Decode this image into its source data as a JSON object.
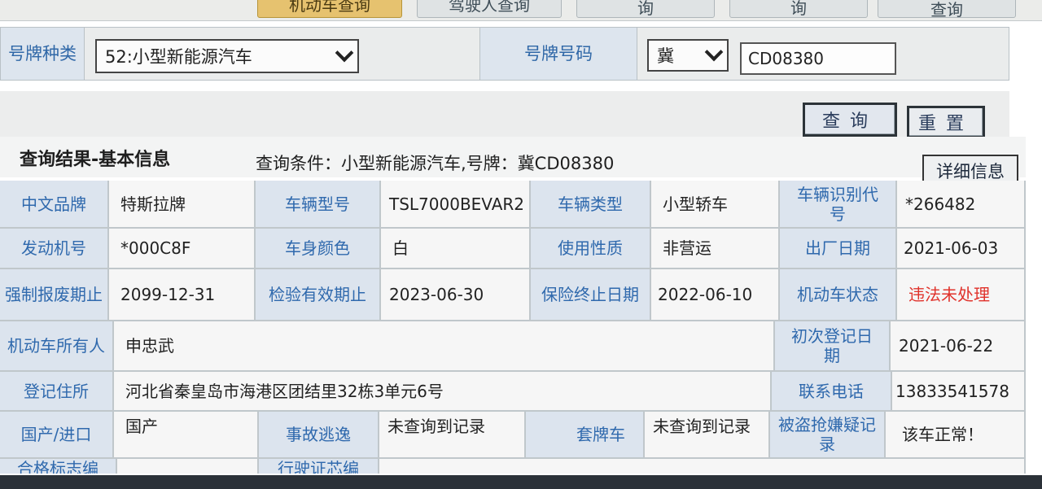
{
  "tabs": [
    {
      "label": "机动车查询",
      "active": true
    },
    {
      "label": "驾驶人查询"
    },
    {
      "label": "询"
    },
    {
      "label": "询"
    },
    {
      "label": "查询"
    }
  ],
  "form": {
    "plate_type_label": "号牌种类",
    "plate_type_value": "52:小型新能源汽车",
    "plate_no_label": "号牌号码",
    "province_value": "冀",
    "plate_no_value": "CD08380",
    "query_button": "查询",
    "reset_button": "重置"
  },
  "result": {
    "title": "查询结果-基本信息",
    "condition": "查询条件：小型新能源汽车,号牌：冀CD08380",
    "detail_button": "详细信息"
  },
  "info": {
    "brand_label": "中文品牌",
    "brand": "特斯拉牌",
    "model_label": "车辆型号",
    "model": "TSL7000BEVAR2",
    "vtype_label": "车辆类型",
    "vtype": "小型轿车",
    "vin_label": "车辆识别代号",
    "vin": "*266482",
    "engine_label": "发动机号",
    "engine": "*000C8F",
    "color_label": "车身颜色",
    "color": "白",
    "usage_label": "使用性质",
    "usage": "非营运",
    "mfg_label": "出厂日期",
    "mfg": "2021-06-03",
    "scrap_label": "强制报废期止",
    "scrap": "2099-12-31",
    "inspect_label": "检验有效期止",
    "inspect": "2023-06-30",
    "insure_label": "保险终止日期",
    "insure": "2022-06-10",
    "status_label": "机动车状态",
    "status": "违法未处理",
    "owner_label": "机动车所有人",
    "owner": "申忠武",
    "reg_label": "初次登记日期",
    "reg": "2021-06-22",
    "addr_label": "登记住所",
    "addr": "河北省秦皇岛市海港区团结里32栋3单元6号",
    "phone_label": "联系电话",
    "phone": "13833541578",
    "origin_label": "国产/进口",
    "origin": "国产",
    "hitrun_label": "事故逃逸",
    "hitrun": "未查询到记录",
    "fake_label": "套牌车",
    "fake": "未查询到记录",
    "stolen_label": "被盗抢嫌疑记录",
    "stolen": "该车正常！",
    "cert_label": "合格标志编",
    "license_label": "行驶证芯编"
  },
  "colors": {
    "label_text": "#2f69ad",
    "alert_text": "#e0322b",
    "active_tab": "#e6c26f"
  }
}
